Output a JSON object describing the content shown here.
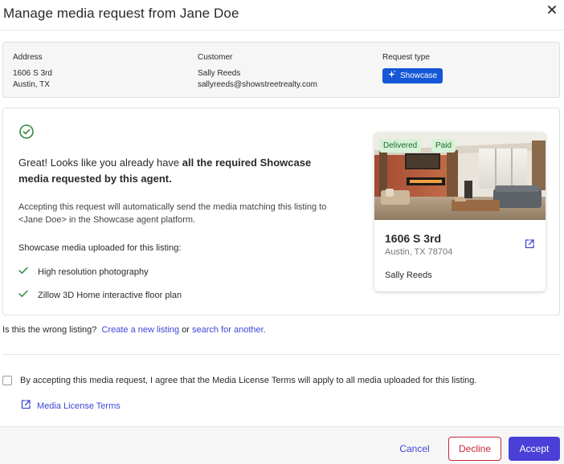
{
  "header": {
    "title": "Manage media request from Jane Doe"
  },
  "summary": {
    "address_label": "Address",
    "address_line1": "1606 S 3rd",
    "address_line2": "Austin, TX",
    "customer_label": "Customer",
    "customer_name": "Sally Reeds",
    "customer_email": "sallyreeds@showstreetrealty.com",
    "request_type_label": "Request type",
    "request_type_value": "Showcase"
  },
  "panel": {
    "intro_plain": "Great! Looks like you already have ",
    "intro_bold": "all the required Showcase media requested by this agent.",
    "description": "Accepting this request will automatically send the media matching this listing to <Jane Doe> in the Showcase agent platform.",
    "uploaded_heading": "Showcase media uploaded for this listing:",
    "media_items": [
      "High resolution photography",
      "Zillow 3D Home interactive floor plan"
    ]
  },
  "card": {
    "badges": [
      "Delivered",
      "Paid"
    ],
    "address": "1606 S 3rd",
    "city": "Austin, TX 78704",
    "agent": "Sally Reeds"
  },
  "wrong_listing": {
    "prefix": "Is this the wrong listing?",
    "create_link": "Create a new listing",
    "or": "or",
    "search_link": "search for another."
  },
  "agreement": {
    "checkbox_text": "By accepting this media request, I agree that the Media License Terms will apply to all media uploaded for this listing.",
    "license_link": "Media License Terms",
    "checked": false
  },
  "footer": {
    "cancel_label": "Cancel",
    "decline_label": "Decline",
    "accept_label": "Accept"
  },
  "colors": {
    "accent": "#4a3fd6",
    "link": "#3d46d6",
    "showcase_badge": "#1557d6",
    "decline": "#c7283a",
    "success": "#2e8b3e",
    "pill_bg": "#d7f2d8"
  },
  "icons": {
    "close": "close-icon",
    "success_check": "check-circle-icon",
    "sparkle": "sparkle-icon",
    "check": "check-icon",
    "external": "external-link-icon"
  }
}
